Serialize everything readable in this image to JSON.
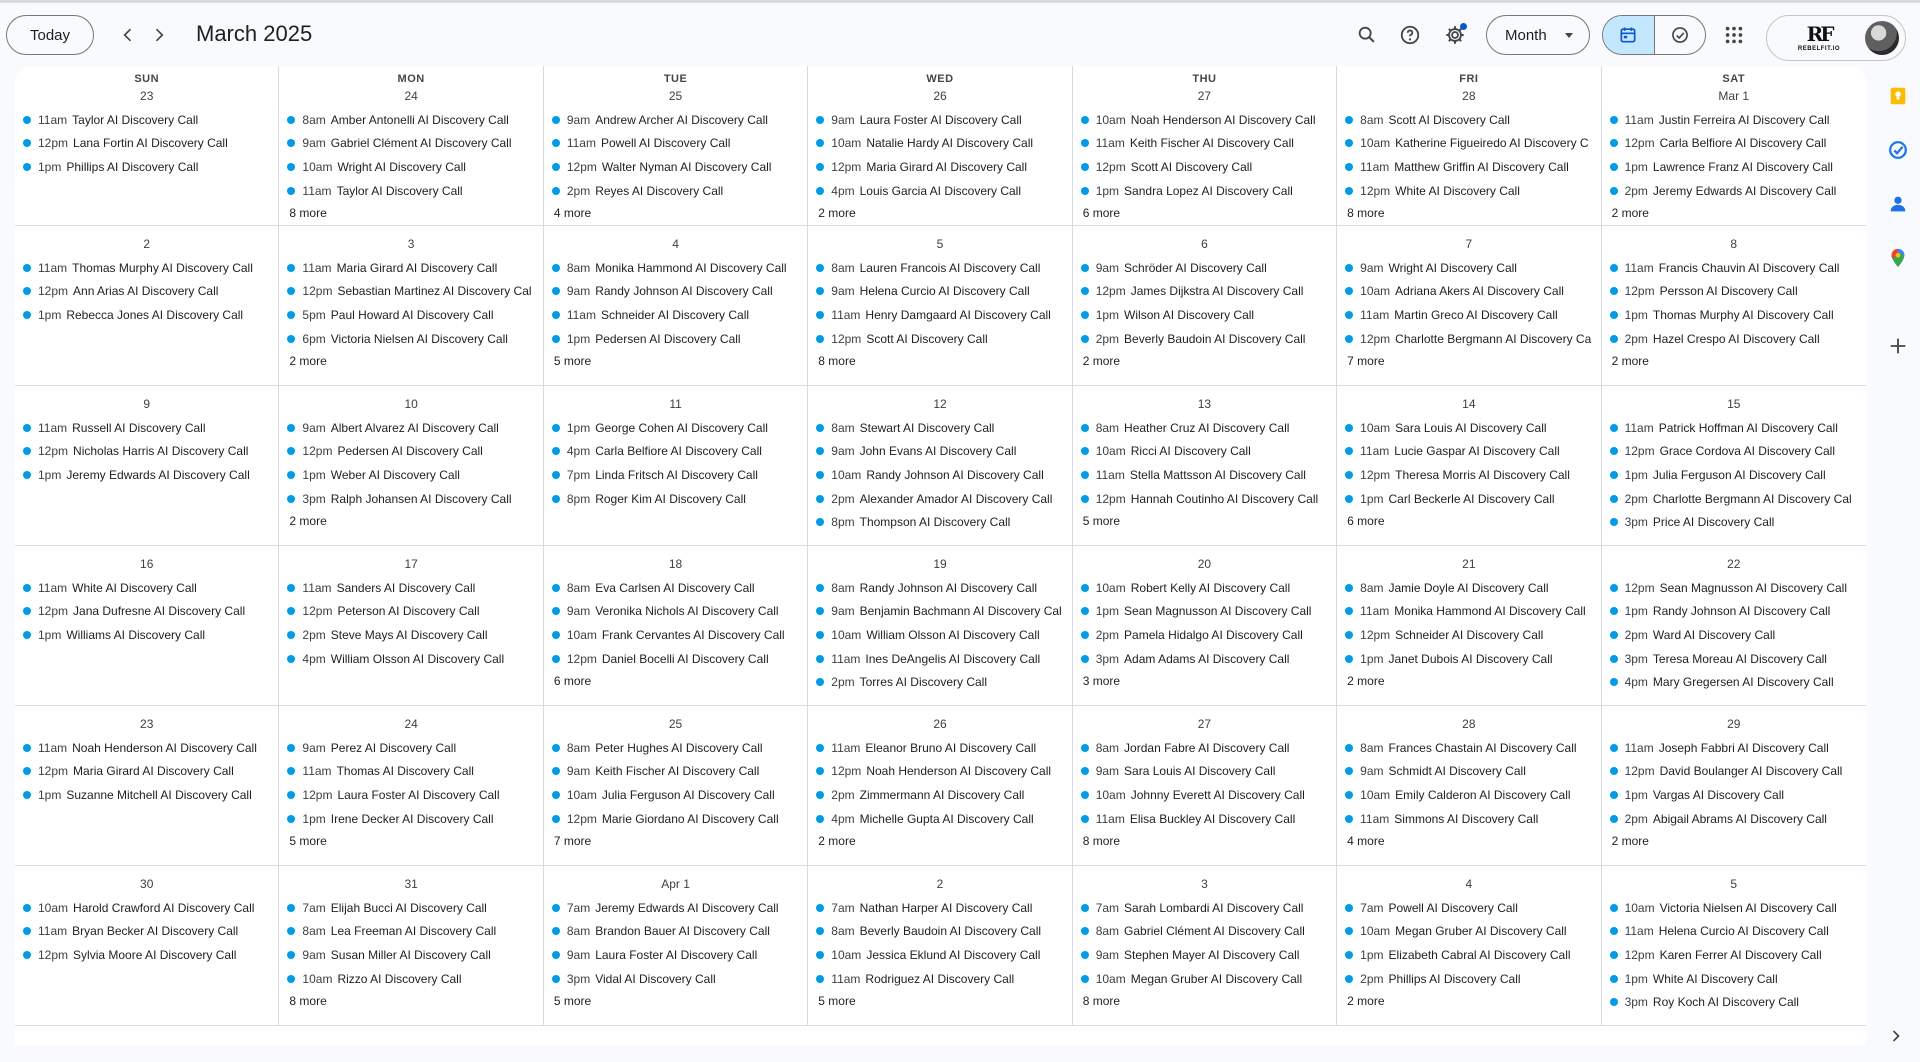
{
  "header": {
    "today_label": "Today",
    "month_title": "March 2025",
    "view_select": "Month"
  },
  "account": {
    "logo_mark": "RF",
    "logo_text": "REBELFIT.IO"
  },
  "colors": {
    "event_dot": "#039be5",
    "active_view": "#c2e7ff",
    "accent": "#0b57d0"
  },
  "weekday_labels": [
    "SUN",
    "MON",
    "TUE",
    "WED",
    "THU",
    "FRI",
    "SAT"
  ],
  "weeks": [
    [
      {
        "date": "23",
        "events": [
          [
            "11am",
            "Taylor AI Discovery Call"
          ],
          [
            "12pm",
            "Lana Fortin AI Discovery Call"
          ],
          [
            "1pm",
            "Phillips AI Discovery Call"
          ]
        ],
        "more": ""
      },
      {
        "date": "24",
        "events": [
          [
            "8am",
            "Amber Antonelli AI Discovery Call"
          ],
          [
            "9am",
            "Gabriel Clément AI Discovery Call"
          ],
          [
            "10am",
            "Wright AI Discovery Call"
          ],
          [
            "11am",
            "Taylor AI Discovery Call"
          ]
        ],
        "more": "8 more"
      },
      {
        "date": "25",
        "events": [
          [
            "9am",
            "Andrew Archer AI Discovery Call"
          ],
          [
            "11am",
            "Powell AI Discovery Call"
          ],
          [
            "12pm",
            "Walter Nyman AI Discovery Call"
          ],
          [
            "2pm",
            "Reyes AI Discovery Call"
          ]
        ],
        "more": "4 more"
      },
      {
        "date": "26",
        "events": [
          [
            "9am",
            "Laura Foster AI Discovery Call"
          ],
          [
            "10am",
            "Natalie Hardy AI Discovery Call"
          ],
          [
            "12pm",
            "Maria Girard AI Discovery Call"
          ],
          [
            "4pm",
            "Louis Garcia AI Discovery Call"
          ]
        ],
        "more": "2 more"
      },
      {
        "date": "27",
        "events": [
          [
            "10am",
            "Noah Henderson AI Discovery Call"
          ],
          [
            "11am",
            "Keith Fischer AI Discovery Call"
          ],
          [
            "12pm",
            "Scott AI Discovery Call"
          ],
          [
            "1pm",
            "Sandra Lopez AI Discovery Call"
          ]
        ],
        "more": "6 more"
      },
      {
        "date": "28",
        "events": [
          [
            "8am",
            "Scott AI Discovery Call"
          ],
          [
            "10am",
            "Katherine Figueiredo AI Discovery C"
          ],
          [
            "11am",
            "Matthew Griffin AI Discovery Call"
          ],
          [
            "12pm",
            "White AI Discovery Call"
          ]
        ],
        "more": "8 more"
      },
      {
        "date": "Mar 1",
        "events": [
          [
            "11am",
            "Justin Ferreira AI Discovery Call"
          ],
          [
            "12pm",
            "Carla Belfiore AI Discovery Call"
          ],
          [
            "1pm",
            "Lawrence Franz AI Discovery Call"
          ],
          [
            "2pm",
            "Jeremy Edwards AI Discovery Call"
          ]
        ],
        "more": "2 more"
      }
    ],
    [
      {
        "date": "2",
        "events": [
          [
            "11am",
            "Thomas Murphy AI Discovery Call"
          ],
          [
            "12pm",
            "Ann Arias AI Discovery Call"
          ],
          [
            "1pm",
            "Rebecca Jones AI Discovery Call"
          ]
        ],
        "more": ""
      },
      {
        "date": "3",
        "events": [
          [
            "11am",
            "Maria Girard AI Discovery Call"
          ],
          [
            "12pm",
            "Sebastian Martinez AI Discovery Cal"
          ],
          [
            "5pm",
            "Paul Howard AI Discovery Call"
          ],
          [
            "6pm",
            "Victoria Nielsen AI Discovery Call"
          ]
        ],
        "more": "2 more"
      },
      {
        "date": "4",
        "events": [
          [
            "8am",
            "Monika Hammond AI Discovery Call"
          ],
          [
            "9am",
            "Randy Johnson AI Discovery Call"
          ],
          [
            "11am",
            "Schneider AI Discovery Call"
          ],
          [
            "1pm",
            "Pedersen AI Discovery Call"
          ]
        ],
        "more": "5 more"
      },
      {
        "date": "5",
        "events": [
          [
            "8am",
            "Lauren Francois AI Discovery Call"
          ],
          [
            "9am",
            "Helena Curcio AI Discovery Call"
          ],
          [
            "11am",
            "Henry Damgaard AI Discovery Call"
          ],
          [
            "12pm",
            "Scott AI Discovery Call"
          ]
        ],
        "more": "8 more"
      },
      {
        "date": "6",
        "events": [
          [
            "9am",
            "Schröder AI Discovery Call"
          ],
          [
            "12pm",
            "James Dijkstra AI Discovery Call"
          ],
          [
            "1pm",
            "Wilson AI Discovery Call"
          ],
          [
            "2pm",
            "Beverly Baudoin AI Discovery Call"
          ]
        ],
        "more": "2 more"
      },
      {
        "date": "7",
        "events": [
          [
            "9am",
            "Wright AI Discovery Call"
          ],
          [
            "10am",
            "Adriana Akers AI Discovery Call"
          ],
          [
            "11am",
            "Martin Greco AI Discovery Call"
          ],
          [
            "12pm",
            "Charlotte Bergmann AI Discovery Ca"
          ]
        ],
        "more": "7 more"
      },
      {
        "date": "8",
        "events": [
          [
            "11am",
            "Francis Chauvin AI Discovery Call"
          ],
          [
            "12pm",
            "Persson AI Discovery Call"
          ],
          [
            "1pm",
            "Thomas Murphy AI Discovery Call"
          ],
          [
            "2pm",
            "Hazel Crespo AI Discovery Call"
          ]
        ],
        "more": "2 more"
      }
    ],
    [
      {
        "date": "9",
        "events": [
          [
            "11am",
            "Russell AI Discovery Call"
          ],
          [
            "12pm",
            "Nicholas Harris AI Discovery Call"
          ],
          [
            "1pm",
            "Jeremy Edwards AI Discovery Call"
          ]
        ],
        "more": ""
      },
      {
        "date": "10",
        "events": [
          [
            "9am",
            "Albert Alvarez AI Discovery Call"
          ],
          [
            "12pm",
            "Pedersen AI Discovery Call"
          ],
          [
            "1pm",
            "Weber AI Discovery Call"
          ],
          [
            "3pm",
            "Ralph Johansen AI Discovery Call"
          ]
        ],
        "more": "2 more"
      },
      {
        "date": "11",
        "events": [
          [
            "1pm",
            "George Cohen AI Discovery Call"
          ],
          [
            "4pm",
            "Carla Belfiore AI Discovery Call"
          ],
          [
            "7pm",
            "Linda Fritsch AI Discovery Call"
          ],
          [
            "8pm",
            "Roger Kim AI Discovery Call"
          ]
        ],
        "more": ""
      },
      {
        "date": "12",
        "events": [
          [
            "8am",
            "Stewart AI Discovery Call"
          ],
          [
            "9am",
            "John Evans AI Discovery Call"
          ],
          [
            "10am",
            "Randy Johnson AI Discovery Call"
          ],
          [
            "2pm",
            "Alexander Amador AI Discovery Call"
          ],
          [
            "8pm",
            "Thompson AI Discovery Call"
          ]
        ],
        "more": ""
      },
      {
        "date": "13",
        "events": [
          [
            "8am",
            "Heather Cruz AI Discovery Call"
          ],
          [
            "10am",
            "Ricci AI Discovery Call"
          ],
          [
            "11am",
            "Stella Mattsson AI Discovery Call"
          ],
          [
            "12pm",
            "Hannah Coutinho AI Discovery Call"
          ]
        ],
        "more": "5 more"
      },
      {
        "date": "14",
        "events": [
          [
            "10am",
            "Sara Louis AI Discovery Call"
          ],
          [
            "11am",
            "Lucie Gaspar AI Discovery Call"
          ],
          [
            "12pm",
            "Theresa Morris AI Discovery Call"
          ],
          [
            "1pm",
            "Carl Beckerle AI Discovery Call"
          ]
        ],
        "more": "6 more"
      },
      {
        "date": "15",
        "events": [
          [
            "11am",
            "Patrick Hoffman AI Discovery Call"
          ],
          [
            "12pm",
            "Grace Cordova AI Discovery Call"
          ],
          [
            "1pm",
            "Julia Ferguson AI Discovery Call"
          ],
          [
            "2pm",
            "Charlotte Bergmann AI Discovery Cal"
          ],
          [
            "3pm",
            "Price AI Discovery Call"
          ]
        ],
        "more": ""
      }
    ],
    [
      {
        "date": "16",
        "events": [
          [
            "11am",
            "White AI Discovery Call"
          ],
          [
            "12pm",
            "Jana Dufresne AI Discovery Call"
          ],
          [
            "1pm",
            "Williams AI Discovery Call"
          ]
        ],
        "more": ""
      },
      {
        "date": "17",
        "events": [
          [
            "11am",
            "Sanders AI Discovery Call"
          ],
          [
            "12pm",
            "Peterson AI Discovery Call"
          ],
          [
            "2pm",
            "Steve Mays AI Discovery Call"
          ],
          [
            "4pm",
            "William Olsson AI Discovery Call"
          ]
        ],
        "more": ""
      },
      {
        "date": "18",
        "events": [
          [
            "8am",
            "Eva Carlsen AI Discovery Call"
          ],
          [
            "9am",
            "Veronika Nichols AI Discovery Call"
          ],
          [
            "10am",
            "Frank Cervantes AI Discovery Call"
          ],
          [
            "12pm",
            "Daniel Bocelli AI Discovery Call"
          ]
        ],
        "more": "6 more"
      },
      {
        "date": "19",
        "events": [
          [
            "8am",
            "Randy Johnson AI Discovery Call"
          ],
          [
            "9am",
            "Benjamin Bachmann AI Discovery Cal"
          ],
          [
            "10am",
            "William Olsson AI Discovery Call"
          ],
          [
            "11am",
            "Ines DeAngelis AI Discovery Call"
          ],
          [
            "2pm",
            "Torres AI Discovery Call"
          ]
        ],
        "more": ""
      },
      {
        "date": "20",
        "events": [
          [
            "10am",
            "Robert Kelly AI Discovery Call"
          ],
          [
            "1pm",
            "Sean Magnusson AI Discovery Call"
          ],
          [
            "2pm",
            "Pamela Hidalgo AI Discovery Call"
          ],
          [
            "3pm",
            "Adam Adams AI Discovery Call"
          ]
        ],
        "more": "3 more"
      },
      {
        "date": "21",
        "events": [
          [
            "8am",
            "Jamie Doyle AI Discovery Call"
          ],
          [
            "11am",
            "Monika Hammond AI Discovery Call"
          ],
          [
            "12pm",
            "Schneider AI Discovery Call"
          ],
          [
            "1pm",
            "Janet Dubois AI Discovery Call"
          ]
        ],
        "more": "2 more"
      },
      {
        "date": "22",
        "events": [
          [
            "12pm",
            "Sean Magnusson AI Discovery Call"
          ],
          [
            "1pm",
            "Randy Johnson AI Discovery Call"
          ],
          [
            "2pm",
            "Ward AI Discovery Call"
          ],
          [
            "3pm",
            "Teresa Moreau AI Discovery Call"
          ],
          [
            "4pm",
            "Mary Gregersen AI Discovery Call"
          ]
        ],
        "more": ""
      }
    ],
    [
      {
        "date": "23",
        "events": [
          [
            "11am",
            "Noah Henderson AI Discovery Call"
          ],
          [
            "12pm",
            "Maria Girard AI Discovery Call"
          ],
          [
            "1pm",
            "Suzanne Mitchell AI Discovery Call"
          ]
        ],
        "more": ""
      },
      {
        "date": "24",
        "events": [
          [
            "9am",
            "Perez AI Discovery Call"
          ],
          [
            "11am",
            "Thomas AI Discovery Call"
          ],
          [
            "12pm",
            "Laura Foster AI Discovery Call"
          ],
          [
            "1pm",
            "Irene Decker AI Discovery Call"
          ]
        ],
        "more": "5 more"
      },
      {
        "date": "25",
        "events": [
          [
            "8am",
            "Peter Hughes AI Discovery Call"
          ],
          [
            "9am",
            "Keith Fischer AI Discovery Call"
          ],
          [
            "10am",
            "Julia Ferguson AI Discovery Call"
          ],
          [
            "12pm",
            "Marie Giordano AI Discovery Call"
          ]
        ],
        "more": "7 more"
      },
      {
        "date": "26",
        "events": [
          [
            "11am",
            "Eleanor Bruno AI Discovery Call"
          ],
          [
            "12pm",
            "Noah Henderson AI Discovery Call"
          ],
          [
            "2pm",
            "Zimmermann AI Discovery Call"
          ],
          [
            "4pm",
            "Michelle Gupta AI Discovery Call"
          ]
        ],
        "more": "2 more"
      },
      {
        "date": "27",
        "events": [
          [
            "8am",
            "Jordan Fabre AI Discovery Call"
          ],
          [
            "9am",
            "Sara Louis AI Discovery Call"
          ],
          [
            "10am",
            "Johnny Everett AI Discovery Call"
          ],
          [
            "11am",
            "Elisa Buckley AI Discovery Call"
          ]
        ],
        "more": "8 more"
      },
      {
        "date": "28",
        "events": [
          [
            "8am",
            "Frances Chastain AI Discovery Call"
          ],
          [
            "9am",
            "Schmidt AI Discovery Call"
          ],
          [
            "10am",
            "Emily Calderon AI Discovery Call"
          ],
          [
            "11am",
            "Simmons AI Discovery Call"
          ]
        ],
        "more": "4 more"
      },
      {
        "date": "29",
        "events": [
          [
            "11am",
            "Joseph Fabbri AI Discovery Call"
          ],
          [
            "12pm",
            "David Boulanger AI Discovery Call"
          ],
          [
            "1pm",
            "Vargas AI Discovery Call"
          ],
          [
            "2pm",
            "Abigail Abrams AI Discovery Call"
          ]
        ],
        "more": "2 more"
      }
    ],
    [
      {
        "date": "30",
        "events": [
          [
            "10am",
            "Harold Crawford AI Discovery Call"
          ],
          [
            "11am",
            "Bryan Becker AI Discovery Call"
          ],
          [
            "12pm",
            "Sylvia Moore AI Discovery Call"
          ]
        ],
        "more": ""
      },
      {
        "date": "31",
        "events": [
          [
            "7am",
            "Elijah Bucci AI Discovery Call"
          ],
          [
            "8am",
            "Lea Freeman AI Discovery Call"
          ],
          [
            "9am",
            "Susan Miller AI Discovery Call"
          ],
          [
            "10am",
            "Rizzo AI Discovery Call"
          ]
        ],
        "more": "8 more"
      },
      {
        "date": "Apr 1",
        "events": [
          [
            "7am",
            "Jeremy Edwards AI Discovery Call"
          ],
          [
            "8am",
            "Brandon Bauer AI Discovery Call"
          ],
          [
            "9am",
            "Laura Foster AI Discovery Call"
          ],
          [
            "3pm",
            "Vidal AI Discovery Call"
          ]
        ],
        "more": "5 more"
      },
      {
        "date": "2",
        "events": [
          [
            "7am",
            "Nathan Harper AI Discovery Call"
          ],
          [
            "8am",
            "Beverly Baudoin AI Discovery Call"
          ],
          [
            "10am",
            "Jessica Eklund AI Discovery Call"
          ],
          [
            "11am",
            "Rodriguez AI Discovery Call"
          ]
        ],
        "more": "5 more"
      },
      {
        "date": "3",
        "events": [
          [
            "7am",
            "Sarah Lombardi AI Discovery Call"
          ],
          [
            "8am",
            "Gabriel Clément AI Discovery Call"
          ],
          [
            "9am",
            "Stephen Mayer AI Discovery Call"
          ],
          [
            "10am",
            "Megan Gruber AI Discovery Call"
          ]
        ],
        "more": "8 more"
      },
      {
        "date": "4",
        "events": [
          [
            "7am",
            "Powell AI Discovery Call"
          ],
          [
            "10am",
            "Megan Gruber AI Discovery Call"
          ],
          [
            "1pm",
            "Elizabeth Cabral AI Discovery Call"
          ],
          [
            "2pm",
            "Phillips AI Discovery Call"
          ]
        ],
        "more": "2 more"
      },
      {
        "date": "5",
        "events": [
          [
            "10am",
            "Victoria Nielsen AI Discovery Call"
          ],
          [
            "11am",
            "Helena Curcio AI Discovery Call"
          ],
          [
            "12pm",
            "Karen Ferrer AI Discovery Call"
          ],
          [
            "1pm",
            "White AI Discovery Call"
          ],
          [
            "3pm",
            "Roy Koch AI Discovery Call"
          ]
        ],
        "more": ""
      }
    ]
  ]
}
